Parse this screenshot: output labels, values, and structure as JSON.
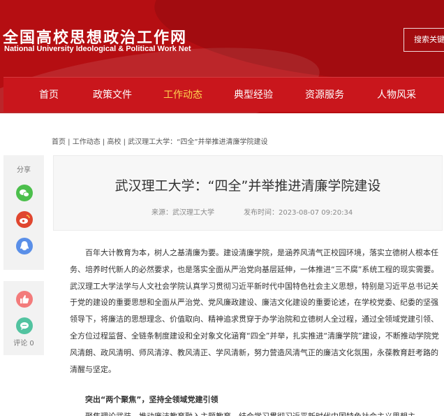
{
  "header": {
    "site_title": "全国高校思想政治工作网",
    "site_subtitle": "National University Ideological & Political Work Net",
    "search_placeholder": "搜索关键词"
  },
  "nav": {
    "items": [
      {
        "label": "首页"
      },
      {
        "label": "政策文件"
      },
      {
        "label": "工作动态"
      },
      {
        "label": "典型经验"
      },
      {
        "label": "资源服务"
      },
      {
        "label": "人物风采"
      }
    ],
    "active": "工作动态"
  },
  "breadcrumb": "首页 | 工作动态 | 高校 | 武汉理工大学：“四全”并举推进清廉学院建设",
  "share": {
    "label": "分享",
    "icons": [
      "wechat-icon",
      "weibo-icon",
      "qq-icon"
    ]
  },
  "actions": {
    "comment_label": "评论 0",
    "icons": [
      "thumbs-up-icon",
      "comment-icon"
    ]
  },
  "article": {
    "title": "武汉理工大学：“四全”并举推进清廉学院建设",
    "source": "来源：武汉理工大学",
    "time": "发布时间：2023-08-07 09:20:34",
    "paragraph1": "百年大计教育为本，树人之基清廉为要。建设清廉学院，是涵养风清气正校园环境，落实立德树人根本任务、培养时代新人的必然要求，也是落实全面从严治党向基层延伸，一体推进“三不腐”系统工程的现实需要。武汉理工大学法学与人文社会学院认真学习贯彻习近平新时代中国特色社会主义思想，特别是习近平总书记关于党的建设的重要思想和全面从严治党、党风廉政建设、廉洁文化建设的重要论述，在学校党委、纪委的坚强领导下，将廉洁的思想理念、价值取向、精神追求贯穿于办学治院和立德树人全过程，通过全领域党建引领、全方位过程监督、全链条制度建设和全对象文化涵育“四全”并举，扎实推进“清廉学院”建设，不断推动学院党风清朗、政风清明、师风清淳、教风清正、学风清新，努力营造风清气正的廉洁文化氛围，永葆教育赶考路的清醒与坚定。",
    "subhead": "突出“两个聚焦”，坚持全领域党建引领",
    "paragraph2": "聚焦理论武装，推动廉洁教育融入主题教育。结合学习贯彻习近平新时代中国特色社会主义思想主"
  },
  "colors": {
    "brand_red": "#b50e12",
    "nav_red": "#c9161c",
    "nav_active": "#ffd34e",
    "wechat_green": "#4cbf4c",
    "weibo_red": "#e0462f",
    "qq_blue": "#5a8fe8",
    "like_pink": "#f37b7b",
    "comment_green": "#52c3a0"
  }
}
